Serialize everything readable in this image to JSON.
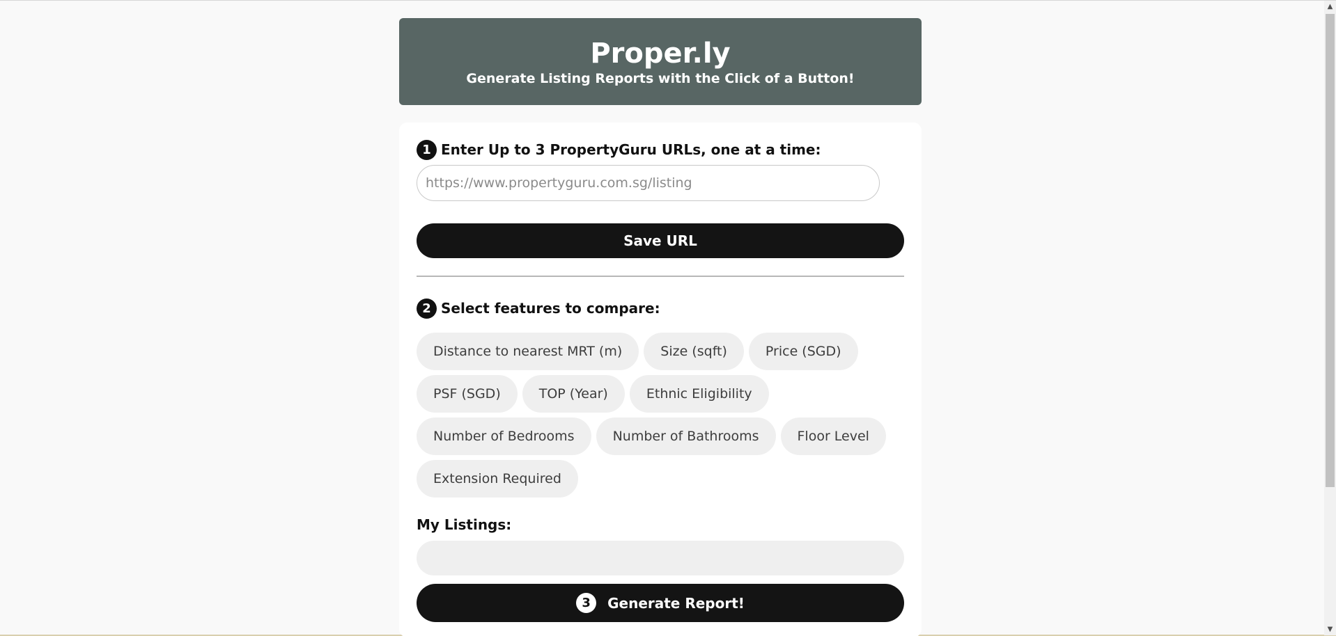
{
  "header": {
    "title": "Proper.ly",
    "subtitle": "Generate Listing Reports with the Click of a Button!"
  },
  "step1": {
    "number": "1",
    "label": "Enter Up to 3 PropertyGuru URLs, one at a time:",
    "url_input": {
      "value": "",
      "placeholder": "https://www.propertyguru.com.sg/listing"
    },
    "save_label": "Save URL"
  },
  "step2": {
    "number": "2",
    "label": "Select features to compare:",
    "features": [
      "Distance to nearest MRT (m)",
      "Size (sqft)",
      "Price (SGD)",
      "PSF (SGD)",
      "TOP (Year)",
      "Ethnic Eligibility",
      "Number of Bedrooms",
      "Number of Bathrooms",
      "Floor Level",
      "Extension Required"
    ]
  },
  "listings": {
    "label": "My Listings:",
    "items": []
  },
  "step3": {
    "number": "3",
    "generate_label": "Generate Report!"
  },
  "scrollbar": {
    "up_icon": "▲",
    "down_icon": "▼"
  },
  "colors": {
    "header_bg": "#586664",
    "button_bg": "#141414",
    "chip_bg": "#efefef",
    "page_bg": "#f9f9f9"
  }
}
